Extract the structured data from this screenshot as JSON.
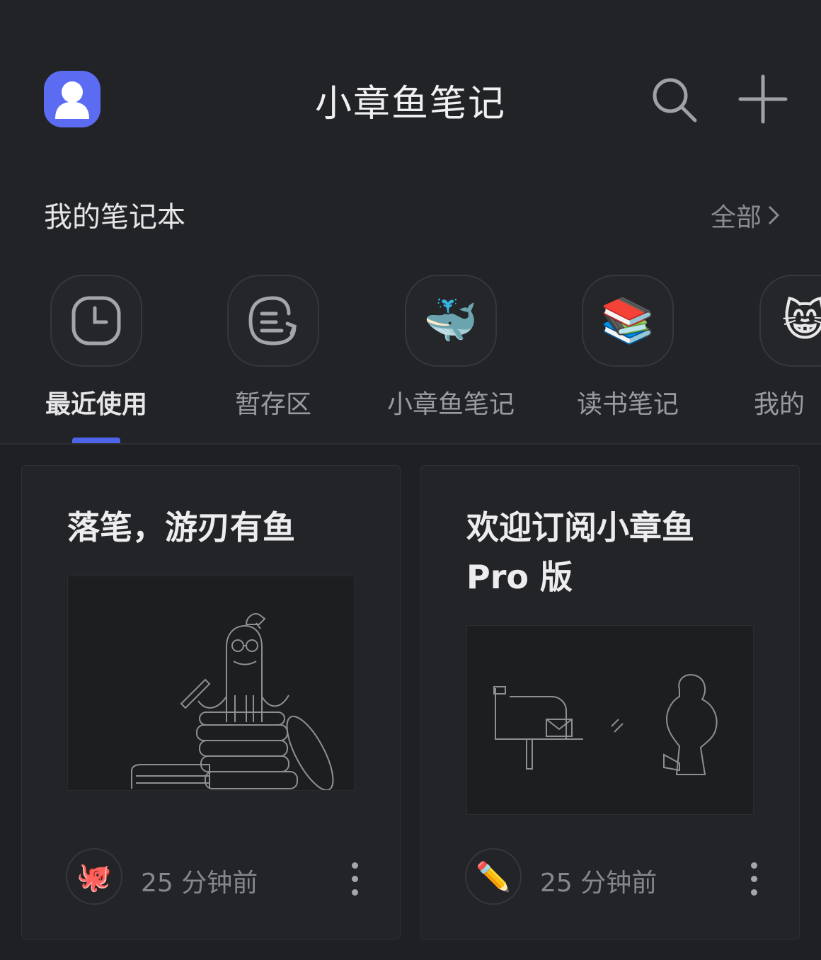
{
  "header": {
    "title": "小章鱼笔记",
    "avatar_icon": "user-avatar-icon",
    "search_icon": "search-icon",
    "add_icon": "plus-icon",
    "accent_color": "#5b6cf2"
  },
  "notebooks": {
    "section_title": "我的笔记本",
    "see_all_label": "全部",
    "items": [
      {
        "label": "最近使用",
        "icon": "clock-icon",
        "active": true
      },
      {
        "label": "暂存区",
        "icon": "inbox-icon",
        "active": false
      },
      {
        "label": "小章鱼笔记",
        "icon": "🐳",
        "active": false
      },
      {
        "label": "读书笔记",
        "icon": "📚",
        "active": false
      },
      {
        "label": "我的",
        "icon": "😸",
        "active": false
      }
    ]
  },
  "notes": [
    {
      "title": "落笔，游刃有鱼",
      "emoji": "🐙",
      "time": "25 分钟前"
    },
    {
      "title": "欢迎订阅小章鱼 Pro 版",
      "emoji": "✏️",
      "time": "25 分钟前"
    }
  ]
}
